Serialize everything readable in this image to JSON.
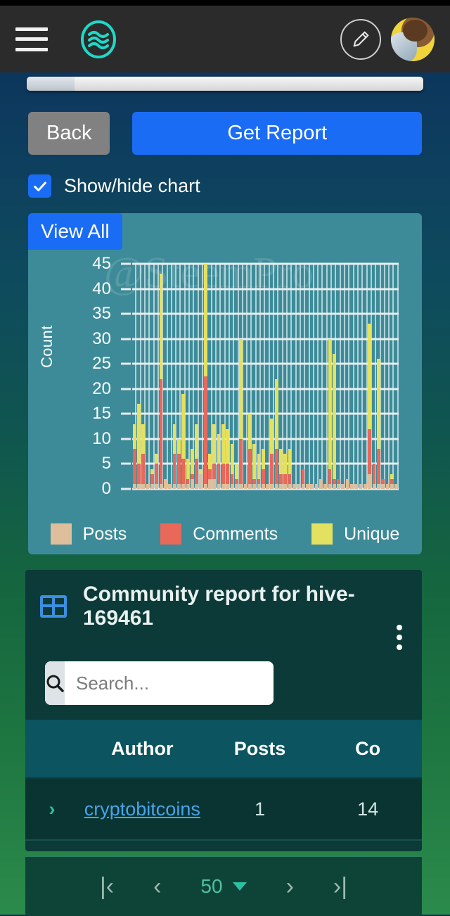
{
  "header": {
    "menu_icon": "hamburger-menu-icon",
    "brand_icon": "steem-wave-logo-icon",
    "edit_icon": "pencil-edit-icon",
    "avatar_icon": "user-avatar"
  },
  "actions": {
    "back_label": "Back",
    "get_report_label": "Get Report",
    "show_hide_label": "Show/hide chart",
    "show_hide_checked": true,
    "view_all_label": "View All"
  },
  "chart_card": {
    "watermark": "@SteemPro"
  },
  "chart_data": {
    "type": "bar",
    "stacked": true,
    "title": "",
    "xlabel": "",
    "ylabel": "Count",
    "ylim": [
      0,
      45
    ],
    "yticks": [
      45,
      40,
      35,
      30,
      25,
      20,
      15,
      10,
      5,
      0
    ],
    "grid": true,
    "legend_position": "bottom",
    "colors": {
      "Posts": "#dfbe9b",
      "Comments": "#e8685a",
      "Unique": "#e5e160"
    },
    "series": [
      {
        "name": "Posts",
        "values": [
          1,
          1,
          1,
          1,
          1,
          1,
          1,
          1,
          2,
          1,
          1,
          1,
          1,
          2,
          1,
          3,
          1,
          2,
          2,
          1,
          1,
          1,
          1,
          1,
          1,
          1,
          1,
          1,
          1,
          1,
          1,
          1,
          1,
          1,
          1,
          1,
          1,
          1,
          1,
          1,
          1,
          1,
          2,
          1,
          1,
          1,
          1,
          1,
          2,
          1,
          1,
          1,
          1,
          3,
          1,
          1,
          1,
          1,
          1,
          1
        ]
      },
      {
        "name": "Comments",
        "values": [
          7,
          4,
          6,
          0,
          2,
          4,
          21,
          0,
          0,
          6,
          6,
          5,
          1,
          1,
          5,
          0,
          22,
          2,
          3,
          4,
          4,
          4,
          2,
          1,
          9,
          0,
          7,
          1,
          1,
          3,
          0,
          6,
          7,
          2,
          2,
          2,
          0,
          0,
          3,
          0,
          0,
          0,
          0,
          0,
          3,
          1,
          1,
          0,
          0,
          0,
          0,
          0,
          0,
          9,
          4,
          7,
          1,
          0,
          1,
          0
        ]
      },
      {
        "name": "Unique",
        "values": [
          5,
          12,
          6,
          0,
          1,
          2,
          21,
          0,
          0,
          6,
          3,
          13,
          4,
          5,
          7,
          1,
          23,
          3,
          8,
          6,
          8,
          7,
          6,
          3,
          20,
          0,
          7,
          7,
          5,
          4,
          0,
          7,
          14,
          5,
          4,
          5,
          0,
          0,
          0,
          0,
          0,
          0,
          0,
          0,
          26,
          25,
          0,
          0,
          0,
          0,
          0,
          0,
          0,
          21,
          0,
          18,
          0,
          0,
          1,
          0
        ]
      }
    ]
  },
  "chart_bars": [
    [
      1,
      7,
      5
    ],
    [
      1,
      4,
      12
    ],
    [
      1,
      6,
      6
    ],
    [
      1,
      0,
      0
    ],
    [
      1,
      2,
      1
    ],
    [
      1,
      4,
      2
    ],
    [
      1,
      21,
      21
    ],
    [
      2,
      0,
      0
    ],
    [
      1,
      0,
      0
    ],
    [
      1,
      6,
      6
    ],
    [
      1,
      6,
      3
    ],
    [
      1,
      5,
      13
    ],
    [
      1,
      1,
      4
    ],
    [
      2,
      1,
      5
    ],
    [
      1,
      5,
      7
    ],
    [
      3,
      0,
      1
    ],
    [
      1,
      22,
      23
    ],
    [
      2,
      2,
      3
    ],
    [
      2,
      3,
      8
    ],
    [
      1,
      4,
      6
    ],
    [
      1,
      4,
      8
    ],
    [
      1,
      4,
      7
    ],
    [
      1,
      2,
      6
    ],
    [
      1,
      1,
      3
    ],
    [
      1,
      9,
      20
    ],
    [
      1,
      0,
      0
    ],
    [
      1,
      7,
      7
    ],
    [
      1,
      1,
      7
    ],
    [
      1,
      1,
      5
    ],
    [
      1,
      3,
      4
    ],
    [
      1,
      0,
      0
    ],
    [
      1,
      6,
      7
    ],
    [
      1,
      7,
      14
    ],
    [
      1,
      2,
      5
    ],
    [
      1,
      2,
      4
    ],
    [
      1,
      2,
      5
    ],
    [
      1,
      0,
      0
    ],
    [
      1,
      0,
      0
    ],
    [
      1,
      3,
      0
    ],
    [
      1,
      0,
      0
    ],
    [
      1,
      0,
      0
    ],
    [
      1,
      0,
      0
    ],
    [
      2,
      0,
      0
    ],
    [
      1,
      0,
      0
    ],
    [
      1,
      3,
      26
    ],
    [
      1,
      1,
      25
    ],
    [
      1,
      1,
      0
    ],
    [
      1,
      0,
      0
    ],
    [
      2,
      0,
      0
    ],
    [
      1,
      0,
      0
    ],
    [
      1,
      0,
      0
    ],
    [
      1,
      0,
      0
    ],
    [
      1,
      0,
      0
    ],
    [
      3,
      9,
      21
    ],
    [
      1,
      4,
      0
    ],
    [
      1,
      7,
      18
    ],
    [
      1,
      1,
      0
    ],
    [
      1,
      0,
      0
    ],
    [
      1,
      1,
      1
    ],
    [
      1,
      0,
      0
    ]
  ],
  "legend": [
    {
      "label": "Posts",
      "color": "#dfbe9b"
    },
    {
      "label": "Comments",
      "color": "#e8685a"
    },
    {
      "label": "Unique",
      "color": "#e5e160"
    }
  ],
  "report": {
    "icon": "table-grid-icon",
    "title": "Community report for hive-169461",
    "menu_icon": "kebab-menu-icon",
    "search": {
      "placeholder": "Search...",
      "value": "",
      "icon": "search-icon"
    },
    "columns": [
      "",
      "Author",
      "Posts",
      "Co"
    ],
    "rows": [
      {
        "expand": "›",
        "author": "cryptobitcoins",
        "posts": "1",
        "comments": "14"
      }
    ]
  },
  "pagination": {
    "first_label": "|‹",
    "prev_label": "‹",
    "page_size": "50",
    "next_label": "›",
    "last_label": "›|"
  }
}
